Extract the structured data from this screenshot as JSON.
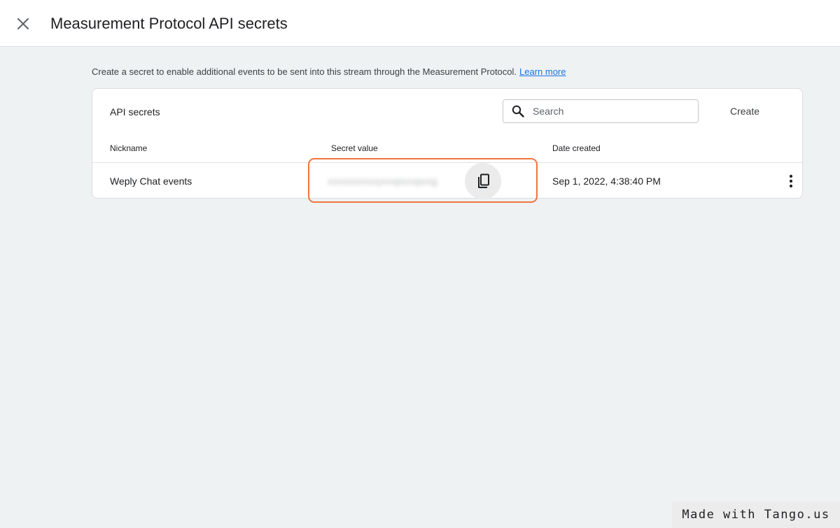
{
  "header": {
    "title": "Measurement Protocol API secrets",
    "close_icon": "close-icon"
  },
  "description": {
    "text": "Create a secret to enable additional events to be sent into this stream through the Measurement Protocol.",
    "link_text": "Learn more"
  },
  "card": {
    "title": "API secrets",
    "search": {
      "placeholder": "Search",
      "value": "",
      "icon": "search-icon"
    },
    "create_label": "Create",
    "columns": [
      "Nickname",
      "Secret value",
      "Date created"
    ],
    "rows": [
      {
        "nickname": "Weply Chat events",
        "secret_value": "xxxxxxxxxxyxxxpxxxpxxg",
        "date_created": "Sep 1, 2022, 4:38:40 PM",
        "copy_icon": "copy-icon",
        "more_icon": "more-vert-icon"
      }
    ]
  },
  "annotation": {
    "highlight_color": "#f0753e"
  },
  "watermark": {
    "text": "Made with Tango.us"
  },
  "colors": {
    "background": "#eef2f3",
    "link": "#1a73e8",
    "text": "#202124"
  }
}
